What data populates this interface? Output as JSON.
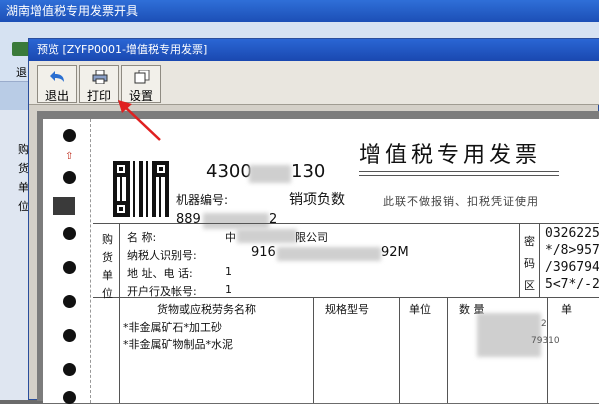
{
  "outer_window": {
    "title": "湖南增值税专用发票开具",
    "toolbar_label": "退",
    "side_labels": [
      "购",
      "货",
      "单",
      "位"
    ]
  },
  "dialog": {
    "title": "预览 [ZYFP0001-增值税专用发票]",
    "buttons": {
      "exit": "退出",
      "print": "打印",
      "settings": "设置"
    }
  },
  "invoice": {
    "title": "增值税专用发票",
    "subtitle": "此联不做报销、扣税凭证使用",
    "code_prefix": "4300",
    "code_suffix": "130",
    "machine_label": "机器编号:",
    "machine_prefix": "889",
    "machine_suffix": "2",
    "sales_list_label": "销项负数",
    "buyer_col": [
      "购",
      "货",
      "单",
      "位"
    ],
    "buyer_rows": [
      {
        "label": "名       称:",
        "value_prefix": "中",
        "value_suffix": "限公司"
      },
      {
        "label": "纳税人识别号:",
        "value_prefix": "916",
        "value_suffix": "92M"
      },
      {
        "label": "地 址、电 话:",
        "value_prefix": "1",
        "value_suffix": ""
      },
      {
        "label": "开户行及帐号:",
        "value_prefix": "1",
        "value_suffix": ""
      }
    ],
    "cipher_label": [
      "密",
      "码",
      "区"
    ],
    "cipher_lines": [
      "0326225",
      "*/8>957",
      "/396794",
      "5<7*/-2"
    ],
    "table_headers": {
      "item": "货物或应税劳务名称",
      "spec": "规格型号",
      "unit": "单位",
      "qty": "数  量",
      "price": "单"
    },
    "items": [
      "*非金属矿石*加工砂",
      "*非金属矿物制品*水泥"
    ],
    "item_qty_tails": [
      "2",
      "79310"
    ]
  }
}
